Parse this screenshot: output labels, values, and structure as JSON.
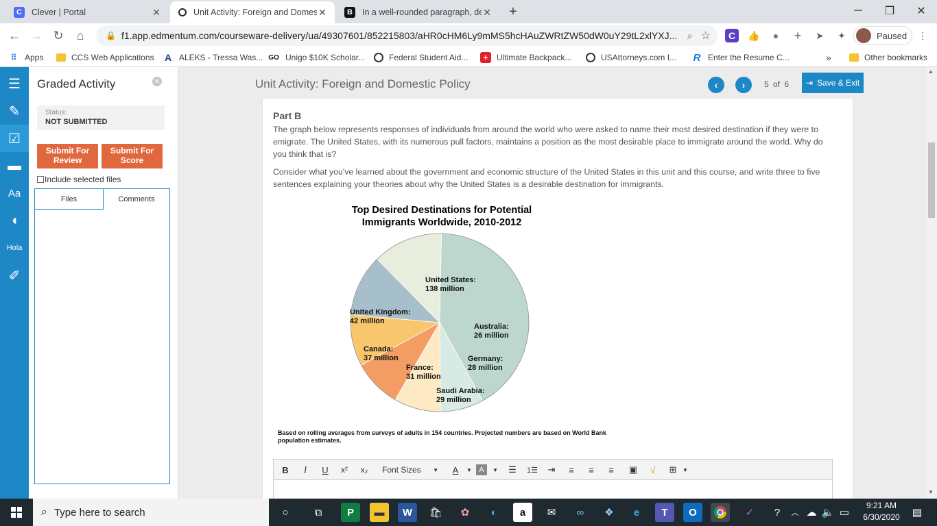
{
  "browser": {
    "tabs": [
      {
        "title": "Clever | Portal",
        "icon": "C",
        "color": "#4a6cf7"
      },
      {
        "title": "Unit Activity: Foreign and Domestic Policy",
        "icon": "e",
        "color": "#222222"
      },
      {
        "title": "In a well-rounded paragraph, describe",
        "icon": "B",
        "color": "#111111"
      }
    ],
    "new_tab": "+",
    "url": "f1.app.edmentum.com/courseware-delivery/ua/49307601/852215803/aHR0cHM6Ly9mMS5hcHAuZWRtZW50dW0uY29tL2xlYXJ...",
    "profile_label": "Paused",
    "bookmarks": [
      "Apps",
      "CCS Web Applications",
      "ALEKS - Tressa Was...",
      "Unigo $10K Scholar...",
      "Federal Student Aid...",
      "Ultimate Backpack...",
      "USAttorneys.com I...",
      "Enter the Resume C...",
      "Other bookmarks"
    ],
    "bookmarks_overflow": "»"
  },
  "panel": {
    "title": "Graded Activity",
    "status_label": "Status:",
    "status_value": "NOT SUBMITTED",
    "submit_review": "Submit For Review",
    "submit_score": "Submit For Score",
    "include_label": "Include selected files",
    "tab_files": "Files",
    "tab_comments": "Comments"
  },
  "activity": {
    "title": "Unit Activity: Foreign and Domestic Policy",
    "page_current": "5",
    "page_of": "of",
    "page_total": "6",
    "save_exit": "Save & Exit",
    "part": "Part B",
    "para1": "The graph below represents responses of individuals from around the world who were asked to name their most desired destination if they were to emigrate. The United States, with its numerous pull factors, maintains a position as the most desirable place to immigrate around the world. Why do you think that is?",
    "para2": "Consider what you've learned about the government and economic structure of the United States in this unit and this course, and write three to five sentences explaining your theories about why the United States is a desirable destination for immigrants."
  },
  "chart_data": {
    "type": "pie",
    "title": "Top Desired Destinations for Potential Immigrants Worldwide, 2010-2012",
    "title_lines": [
      "Top Desired Destinations for Potential",
      "Immigrants Worldwide, 2010-2012"
    ],
    "unit": "million",
    "slices": [
      {
        "label": "United States:",
        "value": 138,
        "value_label": "138 million",
        "color": "#bdd7cf"
      },
      {
        "label": "Australia:",
        "value": 26,
        "value_label": "26 million",
        "color": "#d7ebe4"
      },
      {
        "label": "Germany:",
        "value": 28,
        "value_label": "28 million",
        "color": "#fde9c4"
      },
      {
        "label": "Saudi Arabia:",
        "value": 29,
        "value_label": "29 million",
        "color": "#f39c63"
      },
      {
        "label": "France:",
        "value": 31,
        "value_label": "31 million",
        "color": "#f8c66d"
      },
      {
        "label": "Canada:",
        "value": 37,
        "value_label": "37 million",
        "color": "#a7bfcb"
      },
      {
        "label": "United Kingdom:",
        "value": 42,
        "value_label": "42 million",
        "color": "#e8eedd"
      }
    ],
    "note": "Based on rolling averages from surveys of adults in 154 countries. Projected numbers are based on World Bank population estimates."
  },
  "editor": {
    "font_sizes": "Font Sizes"
  },
  "taskbar": {
    "search_placeholder": "Type here to search",
    "time": "9:21 AM",
    "date": "6/30/2020"
  }
}
